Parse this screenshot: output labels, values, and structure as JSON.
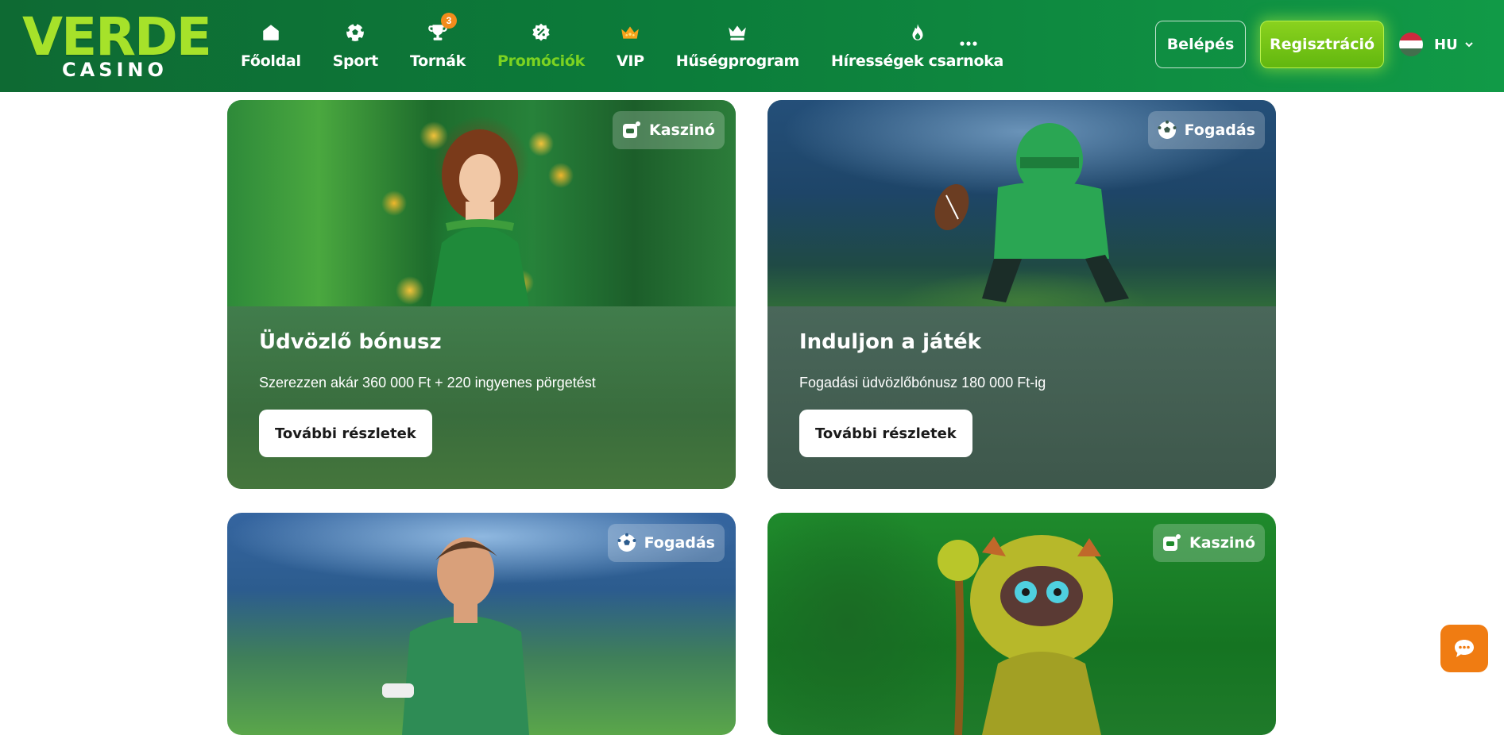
{
  "brand": {
    "name": "VERDE",
    "sub": "CASINO"
  },
  "nav": [
    {
      "label": "Főoldal",
      "icon": "home-icon"
    },
    {
      "label": "Sport",
      "icon": "soccer-ball-icon"
    },
    {
      "label": "Tornák",
      "icon": "trophy-icon",
      "badge": "3"
    },
    {
      "label": "Promóciók",
      "icon": "promo-badge-icon",
      "active": true
    },
    {
      "label": "VIP",
      "icon": "crown-icon"
    },
    {
      "label": "Hűségprogram",
      "icon": "loyalty-crown-icon"
    },
    {
      "label": "Hírességek csarnoka",
      "icon": "flame-icon"
    }
  ],
  "header": {
    "login_label": "Belépés",
    "register_label": "Regisztráció",
    "language": "HU"
  },
  "promos": [
    {
      "tag": "Kaszinó",
      "title": "Üdvözlő bónusz",
      "subtitle": "Szerezzen akár 360 000 Ft + 220 ingyenes pörgetést",
      "button": "További részletek"
    },
    {
      "tag": "Fogadás",
      "title": "Induljon a játék",
      "subtitle": "Fogadási üdvözlőbónusz 180 000 Ft-ig",
      "button": "További részletek"
    },
    {
      "tag": "Fogadás"
    },
    {
      "tag": "Kaszinó"
    }
  ],
  "colors": {
    "header_green": "#0c7c3a",
    "logo_lime": "#a6e22a",
    "active_nav": "#7cd321",
    "register_btn": "#6cbf14",
    "chat_orange": "#f07c12",
    "badge_orange": "#f28c1b"
  }
}
